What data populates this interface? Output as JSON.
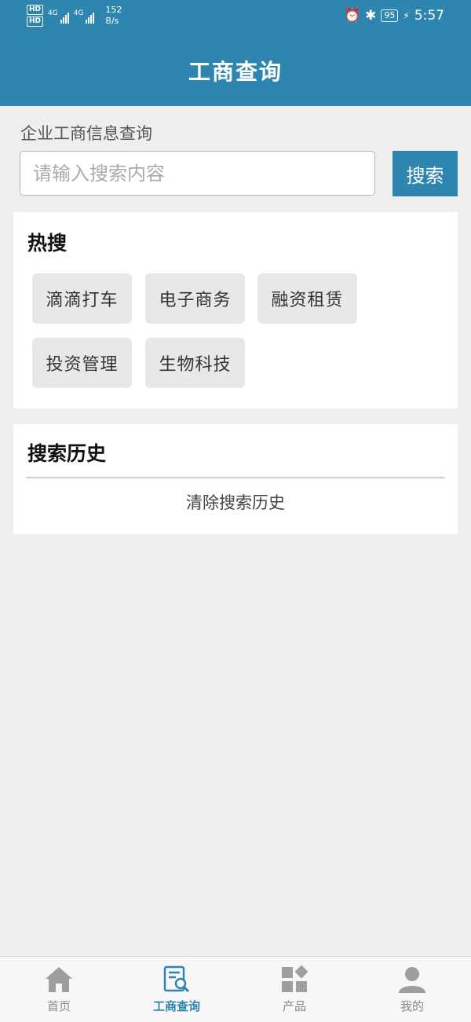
{
  "status_bar": {
    "hd1": "HD",
    "hd2": "HD",
    "net1": "4G",
    "net2": "4G",
    "speed_value": "152",
    "speed_unit": "B/s",
    "battery": "95",
    "time": "5:57"
  },
  "header": {
    "title": "工商查询"
  },
  "search": {
    "label": "企业工商信息查询",
    "placeholder": "请输入搜索内容",
    "value": "",
    "button_label": "搜索"
  },
  "hot_search": {
    "title": "热搜",
    "tags": [
      "滴滴打车",
      "电子商务",
      "融资租赁",
      "投资管理",
      "生物科技"
    ]
  },
  "history": {
    "title": "搜索历史",
    "clear_label": "清除搜索历史"
  },
  "bottom_nav": {
    "items": [
      {
        "label": "首页",
        "icon": "home-icon"
      },
      {
        "label": "工商查询",
        "icon": "document-search-icon",
        "active": true
      },
      {
        "label": "产品",
        "icon": "grid-icon"
      },
      {
        "label": "我的",
        "icon": "user-icon"
      }
    ]
  },
  "colors": {
    "brand": "#2e86b0",
    "page_background": "#eeeeee",
    "tag_background": "#e8e8e8"
  }
}
